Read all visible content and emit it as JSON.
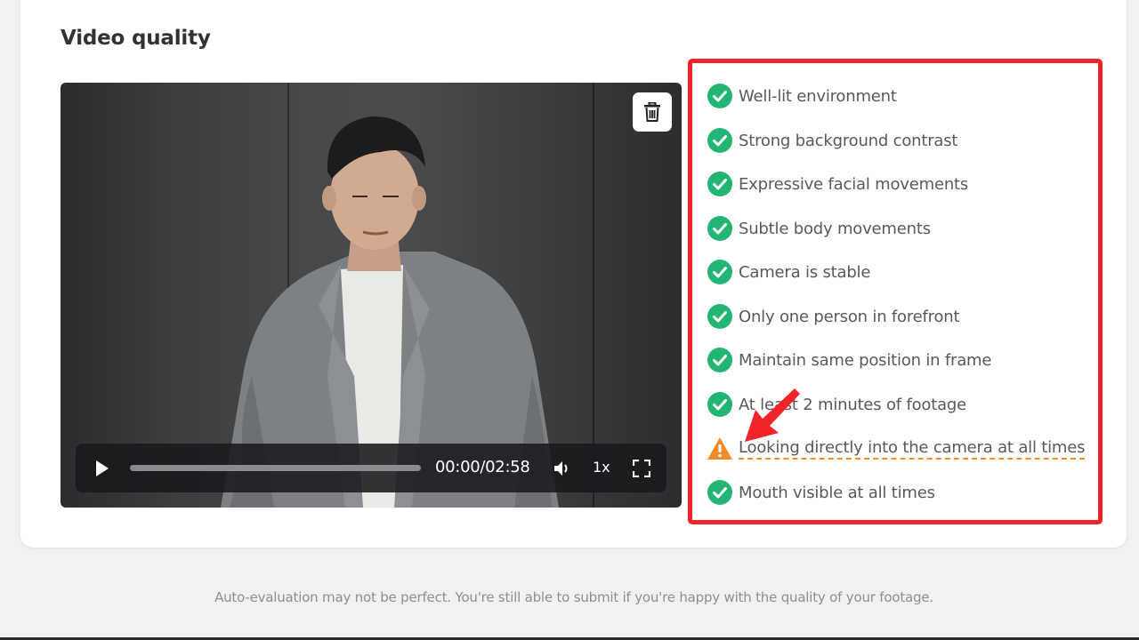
{
  "section": {
    "title": "Video quality"
  },
  "player": {
    "time": "00:00/02:58",
    "speed": "1x",
    "progress_fraction": 0.0,
    "icons": [
      "trash-icon",
      "play-icon",
      "volume-icon",
      "fullscreen-icon"
    ]
  },
  "checklist": {
    "items": [
      {
        "label": "Well-lit environment",
        "status": "pass"
      },
      {
        "label": "Strong background contrast",
        "status": "pass"
      },
      {
        "label": "Expressive facial movements",
        "status": "pass"
      },
      {
        "label": "Subtle body movements",
        "status": "pass"
      },
      {
        "label": "Camera is stable",
        "status": "pass"
      },
      {
        "label": "Only one person in forefront",
        "status": "pass"
      },
      {
        "label": "Maintain same position in frame",
        "status": "pass"
      },
      {
        "label": "At least 2 minutes of footage",
        "status": "pass"
      },
      {
        "label": "Looking directly into the camera at all times",
        "status": "warning"
      },
      {
        "label": "Mouth visible at all times",
        "status": "pass"
      }
    ]
  },
  "footer": {
    "note": "Auto-evaluation may not be perfect. You're still able to submit if you're happy with the quality of your footage."
  },
  "colors": {
    "pass": "#22b573",
    "warning": "#f28c28",
    "highlight": "#f2242a"
  }
}
